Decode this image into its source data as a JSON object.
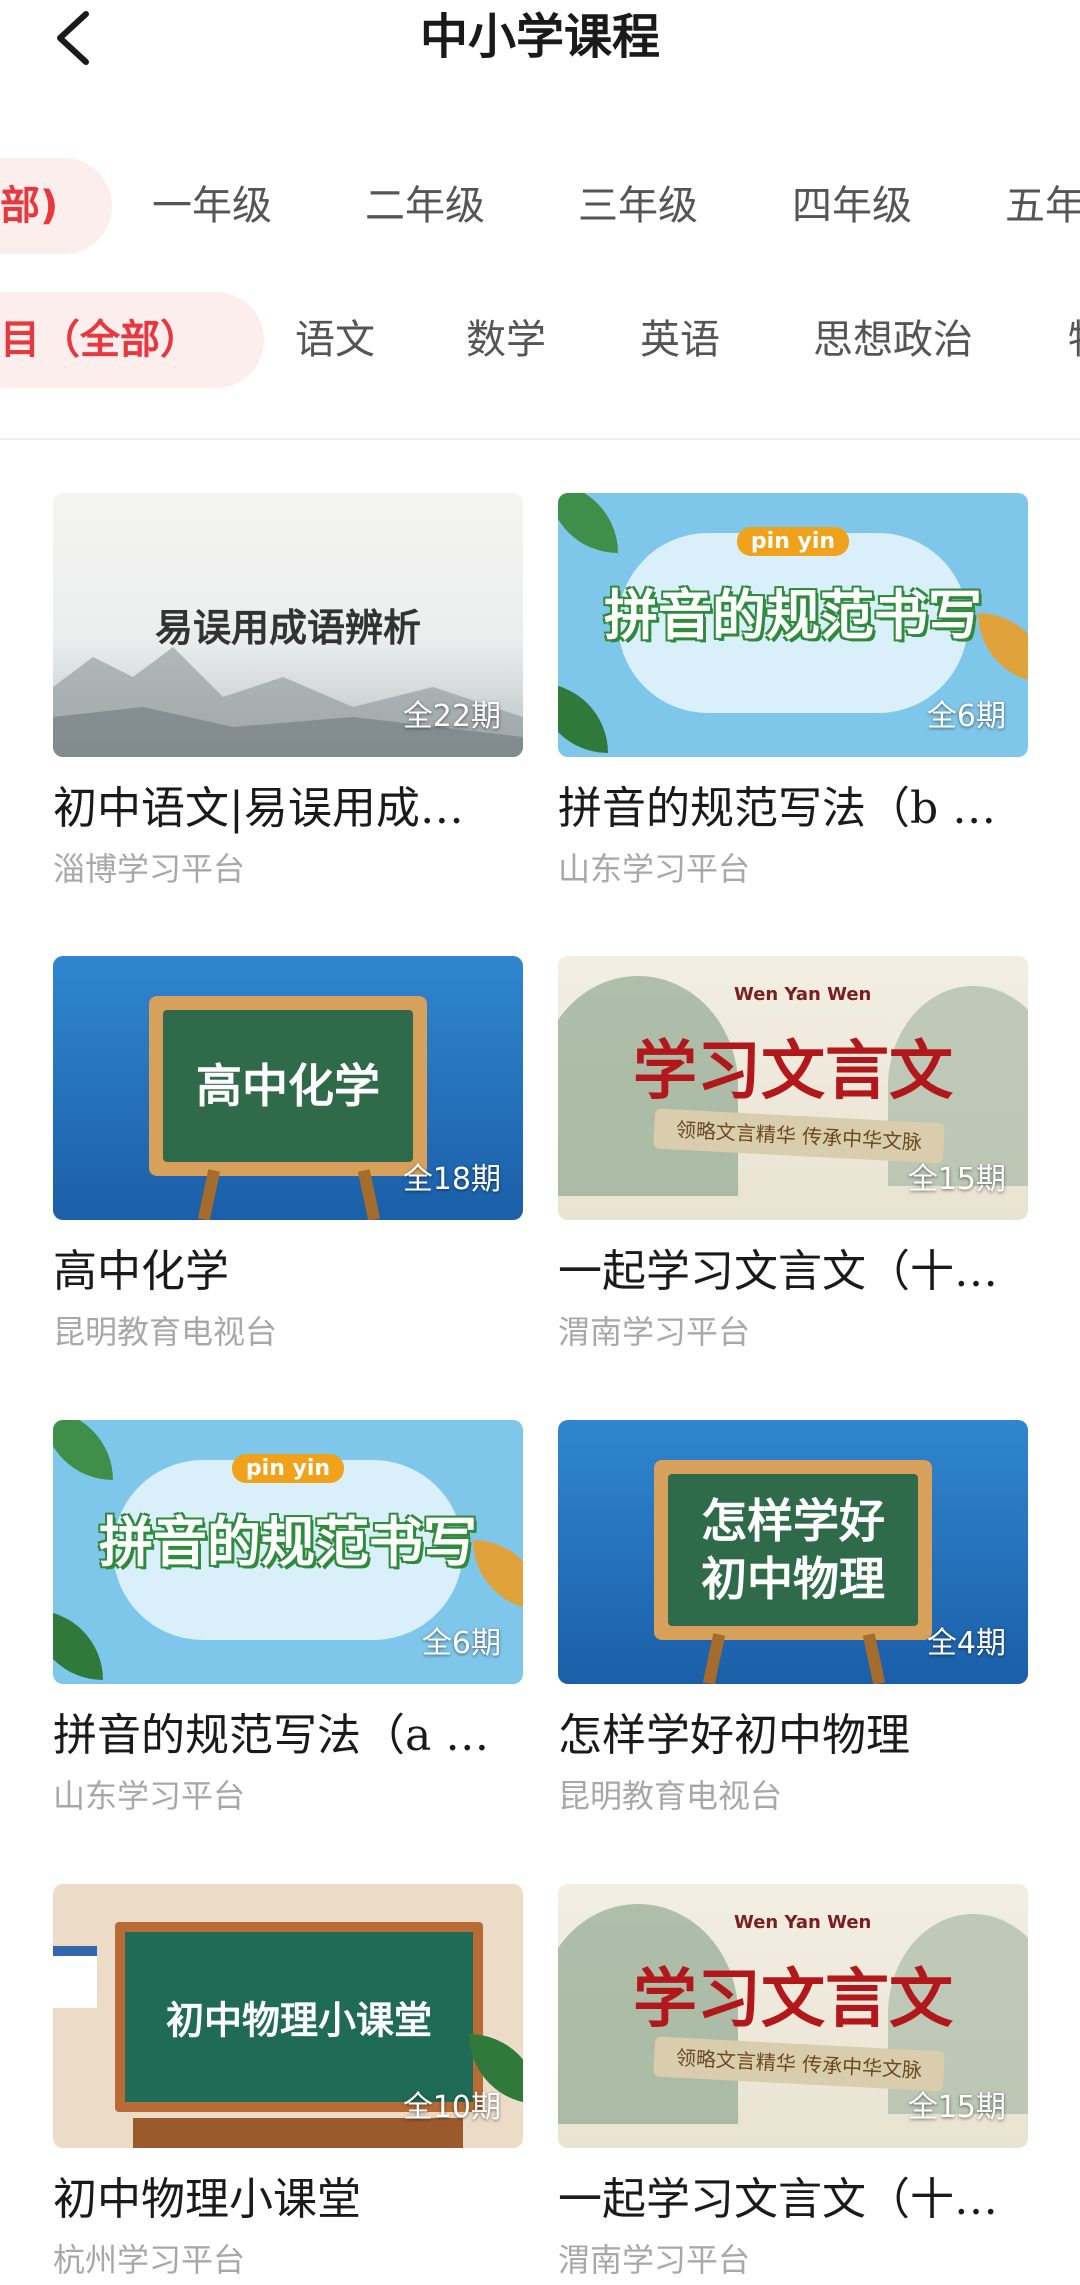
{
  "header": {
    "title": "中小学课程",
    "back_icon": "chevron-left-icon"
  },
  "grade_tabs": [
    {
      "label": "部)",
      "active": true
    },
    {
      "label": "一年级",
      "active": false
    },
    {
      "label": "二年级",
      "active": false
    },
    {
      "label": "三年级",
      "active": false
    },
    {
      "label": "四年级",
      "active": false
    },
    {
      "label": "五年",
      "active": false
    }
  ],
  "subject_tabs": [
    {
      "label": "目（全部）",
      "active": true
    },
    {
      "label": "语文",
      "active": false
    },
    {
      "label": "数学",
      "active": false
    },
    {
      "label": "英语",
      "active": false
    },
    {
      "label": "思想政治",
      "active": false
    },
    {
      "label": "物",
      "active": false
    }
  ],
  "courses": [
    {
      "thumb_text": "易误用成语辨析",
      "episodes": "全22期",
      "title": "初中语文|易误用成…",
      "source": "淄博学习平台"
    },
    {
      "thumb_pinyin": "pin yin",
      "thumb_text": "拼音的规范书写",
      "episodes": "全6期",
      "title": "拼音的规范写法（b …",
      "source": "山东学习平台"
    },
    {
      "thumb_text": "高中化学",
      "episodes": "全18期",
      "title": "高中化学",
      "source": "昆明教育电视台"
    },
    {
      "thumb_logo": "Wen Yan Wen",
      "thumb_text": "学习文言文",
      "thumb_scroll": "领略文言精华 传承中华文脉",
      "episodes": "全15期",
      "title": "一起学习文言文（十…",
      "source": "渭南学习平台"
    },
    {
      "thumb_pinyin": "pin yin",
      "thumb_text": "拼音的规范书写",
      "episodes": "全6期",
      "title": "拼音的规范写法（a …",
      "source": "山东学习平台"
    },
    {
      "thumb_text": "怎样学好\n初中物理",
      "thumb_line1": "怎样学好",
      "thumb_line2": "初中物理",
      "episodes": "全4期",
      "title": "怎样学好初中物理",
      "source": "昆明教育电视台"
    },
    {
      "thumb_text": "初中物理小课堂",
      "episodes": "全10期",
      "title": "初中物理小课堂",
      "source": "杭州学习平台"
    },
    {
      "thumb_logo": "Wen Yan Wen",
      "thumb_text": "学习文言文",
      "thumb_scroll": "领略文言精华 传承中华文脉",
      "episodes": "全15期",
      "title": "一起学习文言文（十…",
      "source": "渭南学习平台"
    }
  ],
  "colors": {
    "accent": "#e8383d",
    "accent_bg": "#fdeeee",
    "source_text": "#a8a8a8"
  }
}
